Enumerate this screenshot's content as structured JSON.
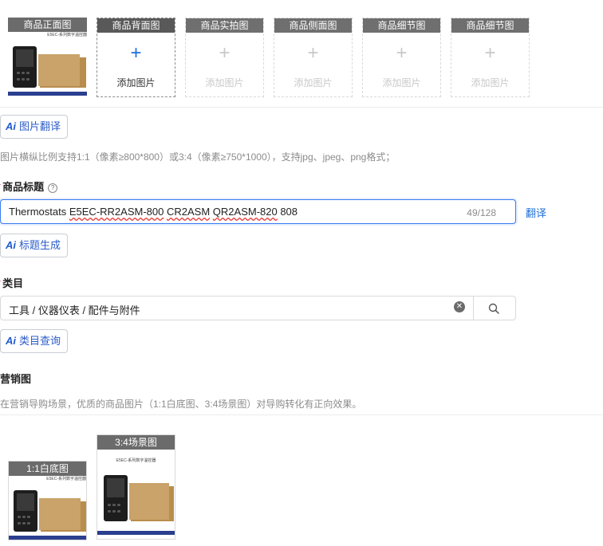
{
  "images": {
    "slots": [
      {
        "caption": "商品正面图",
        "add_label": ""
      },
      {
        "caption": "商品背面图",
        "add_label": "添加图片"
      },
      {
        "caption": "商品实拍图",
        "add_label": "添加图片"
      },
      {
        "caption": "商品侧面图",
        "add_label": "添加图片"
      },
      {
        "caption": "商品细节图",
        "add_label": "添加图片"
      },
      {
        "caption": "商品细节图",
        "add_label": "添加图片"
      }
    ],
    "plus": "+",
    "ai_translate": {
      "icon": "Ai",
      "label": "图片翻译"
    },
    "hint": "图片横纵比例支持1:1（像素≥800*800）或3:4（像素≥750*1000），支持jpg、jpeg、png格式；"
  },
  "product_title": {
    "label": "商品标题",
    "required_mark": "*",
    "value_parts": [
      "Thermostats ",
      "E5EC-RR2ASM-800",
      " ",
      "CR2ASM",
      " ",
      "QR2ASM-820",
      " 808"
    ],
    "count": "49/128",
    "translate_link": "翻译",
    "ai_generate": {
      "icon": "Ai",
      "label": "标题生成"
    }
  },
  "category": {
    "label": "类目",
    "required_mark": "*",
    "value": "工具 / 仪器仪表 / 配件与附件",
    "clear_glyph": "✕",
    "ai_query": {
      "icon": "Ai",
      "label": "类目查询"
    }
  },
  "marketing": {
    "label": "营销图",
    "hint": "在营销导购场景，优质的商品图片（1:1白底图、3:4场景图）对导购转化有正向效果。",
    "slots": [
      {
        "caption": "1:1白底图"
      },
      {
        "caption": "3:4场景图"
      }
    ]
  },
  "photo_banner_text": "E5EC-系列数字温控器",
  "colors": {
    "accent": "#1e6fe0",
    "focus_border": "#3a7bef",
    "required": "#d03030"
  }
}
